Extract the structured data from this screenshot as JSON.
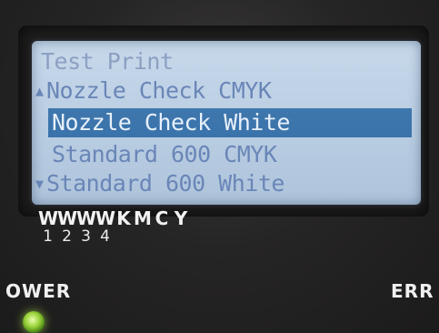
{
  "menu": {
    "title": "Test Print",
    "items": [
      {
        "label": "Nozzle Check CMYK",
        "marker": "▲"
      },
      {
        "label": "Nozzle Check White",
        "marker": ""
      },
      {
        "label": "Standard 600 CMYK",
        "marker": ""
      },
      {
        "label": "Standard 600 White",
        "marker": "▼"
      }
    ],
    "selected_index": 1
  },
  "ink_channels": {
    "letters": [
      "W",
      "W",
      "W",
      "W",
      "K",
      "M",
      "C",
      "Y"
    ],
    "numbers": [
      "1",
      "2",
      "3",
      "4"
    ]
  },
  "panel": {
    "power_label": "OWER",
    "error_label": "ERR"
  },
  "colors": {
    "lcd_background": "#b9cde2",
    "lcd_text": "#6a86b8",
    "highlight": "#3a73ab",
    "power_led": "#9ad23a"
  }
}
